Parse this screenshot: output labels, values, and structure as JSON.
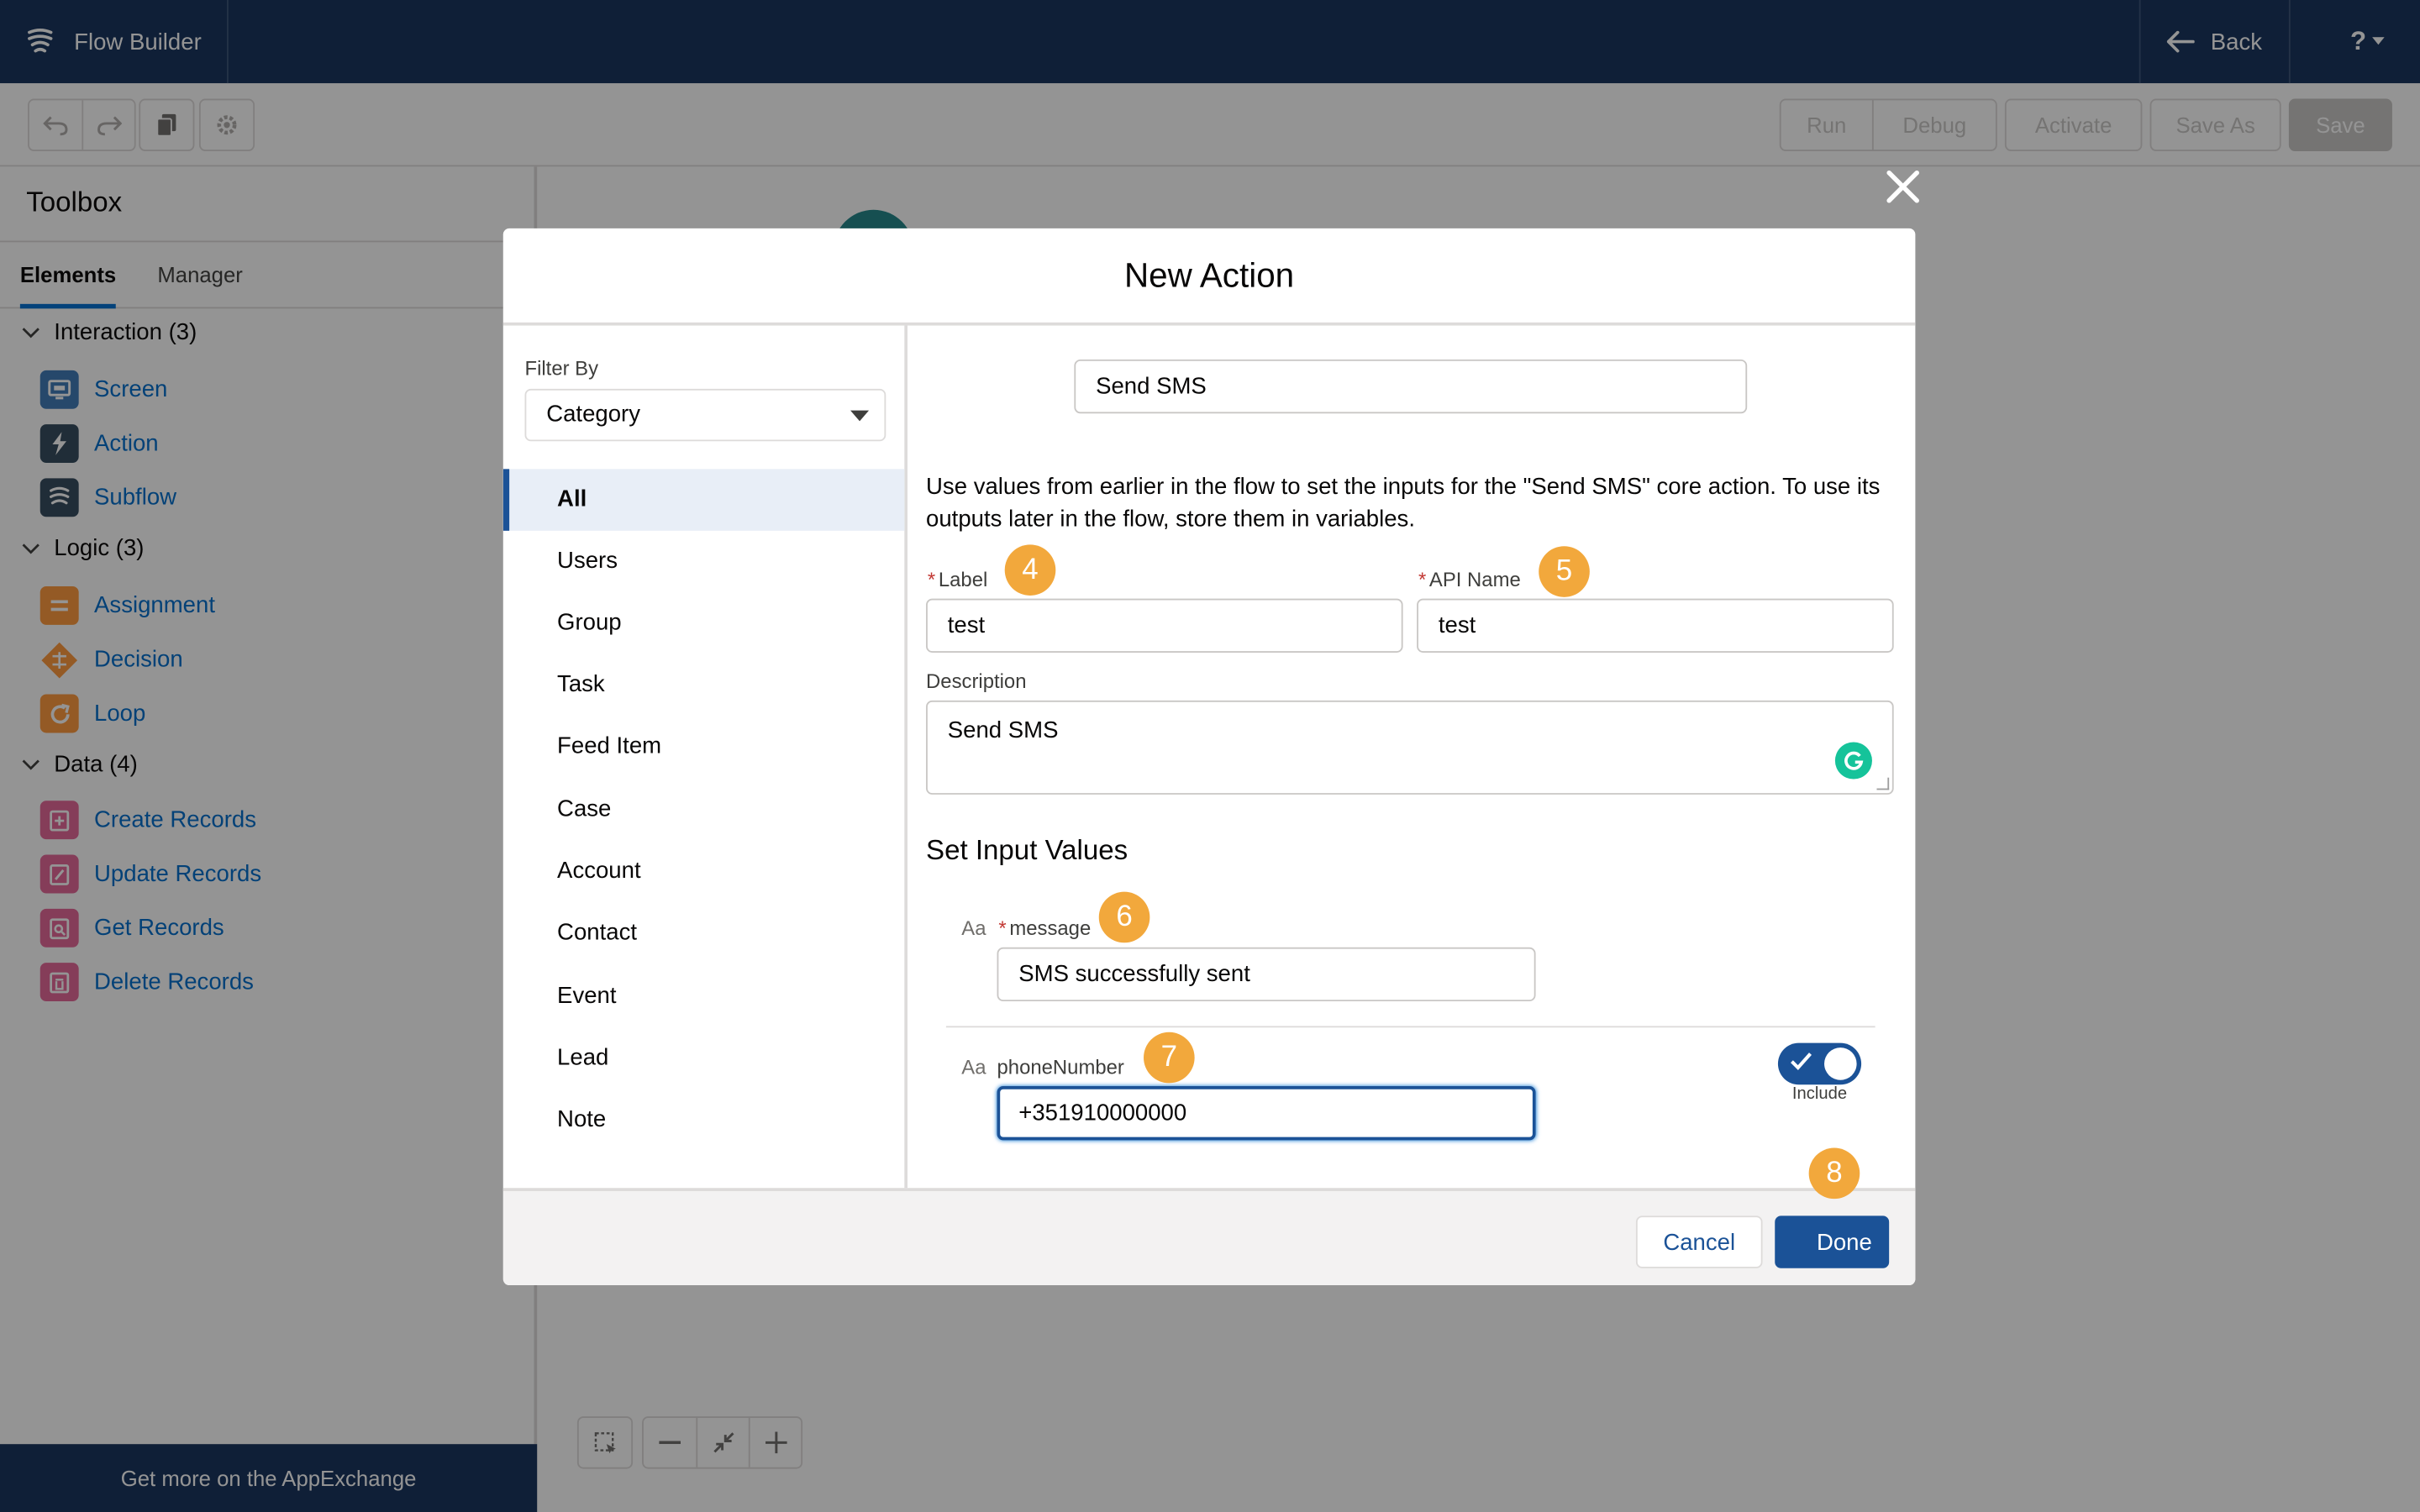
{
  "header": {
    "app_title": "Flow Builder",
    "back_label": "Back",
    "help_label": "?"
  },
  "toolbar": {
    "run": "Run",
    "debug": "Debug",
    "activate": "Activate",
    "save_as": "Save As",
    "save": "Save"
  },
  "toolbox": {
    "title": "Toolbox",
    "tabs": [
      "Elements",
      "Manager"
    ],
    "sections": [
      {
        "label": "Interaction (3)",
        "items": [
          "Screen",
          "Action",
          "Subflow"
        ]
      },
      {
        "label": "Logic (3)",
        "items": [
          "Assignment",
          "Decision",
          "Loop"
        ]
      },
      {
        "label": "Data (4)",
        "items": [
          "Create Records",
          "Update Records",
          "Get Records",
          "Delete Records"
        ]
      }
    ],
    "appexchange": "Get more on the AppExchange"
  },
  "modal": {
    "title": "New Action",
    "filter_label": "Filter By",
    "filter_value": "Category",
    "categories": [
      "All",
      "Users",
      "Group",
      "Task",
      "Feed Item",
      "Case",
      "Account",
      "Contact",
      "Event",
      "Lead",
      "Note"
    ],
    "selected_category": "All",
    "action_search_value": "Send SMS",
    "help_text": "Use values from earlier in the flow to set the inputs for the \"Send SMS\" core action. To use its outputs later in the flow, store them in variables.",
    "label_field": {
      "label": "Label",
      "required": "*",
      "value": "test"
    },
    "api_name_field": {
      "label": "API Name",
      "required": "*",
      "value": "test"
    },
    "description": {
      "label": "Description",
      "value": "Send SMS"
    },
    "set_input_title": "Set Input Values",
    "type_icon_text": "Aa",
    "inputs": [
      {
        "name": "message",
        "required": "*",
        "value": "SMS successfully sent"
      },
      {
        "name": "phoneNumber",
        "value": "+351910000000",
        "include_label": "Include",
        "include_on": true
      }
    ],
    "cancel": "Cancel",
    "done": "Done"
  },
  "steps": [
    "4",
    "5",
    "6",
    "7",
    "8"
  ],
  "colors": {
    "brand_navy": "#16325c",
    "primary_button": "#1b5297",
    "step_badge": "#f2a83c",
    "overlay": "rgba(8,7,7,0.43)"
  }
}
